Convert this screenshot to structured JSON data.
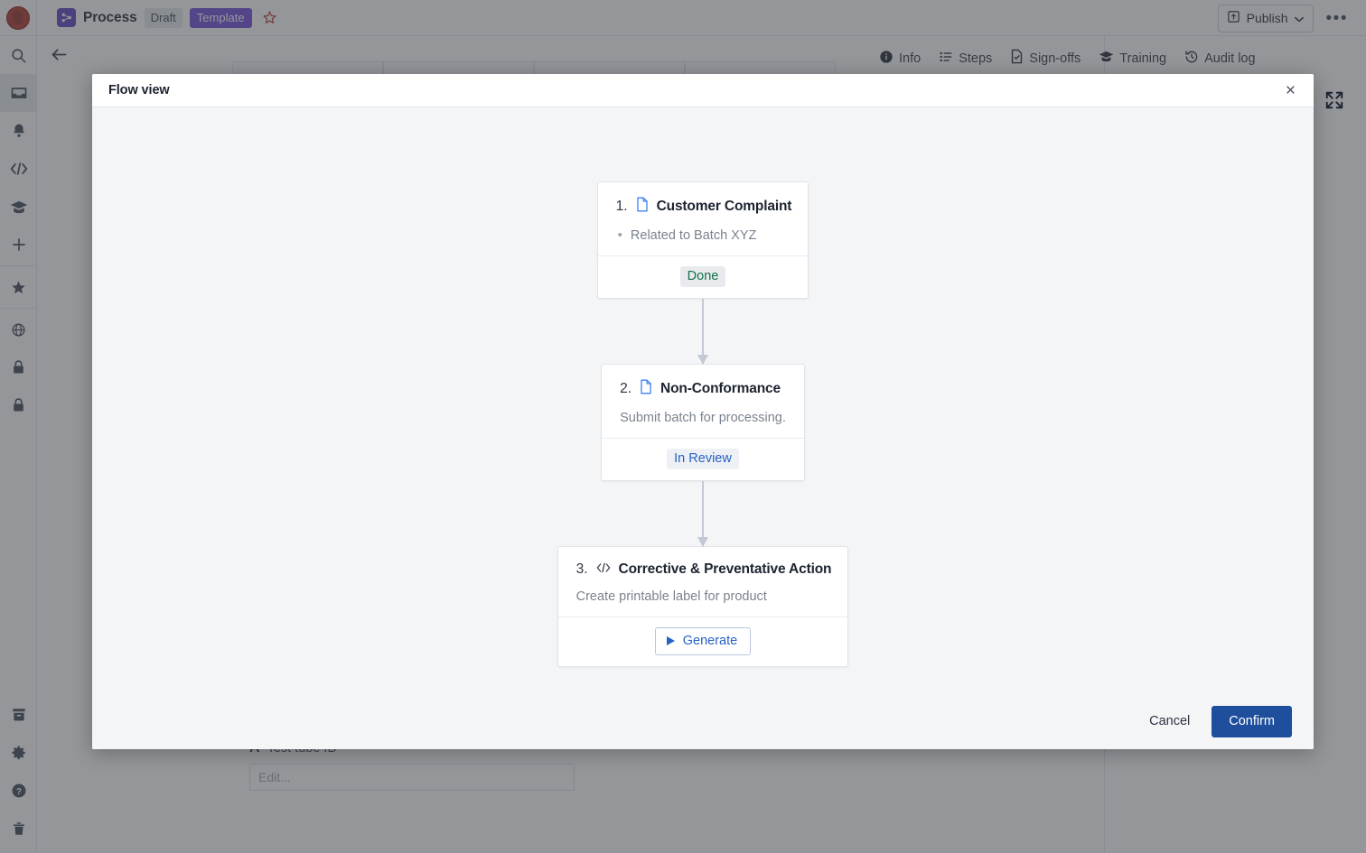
{
  "topbar": {
    "logo_name": "company-logo",
    "doc_icon": "process-flow-icon",
    "doc_title": "Process",
    "status_pill": "Draft",
    "type_pill": "Template",
    "star_icon": "star-outline-icon",
    "publish_label": "Publish",
    "publish_icon": "publish-upload-icon",
    "chevron_icon": "chevron-down-icon",
    "more_label": "•••"
  },
  "sidebar": {
    "items": [
      {
        "name": "search-icon",
        "active": false
      },
      {
        "name": "inbox-icon",
        "active": true
      },
      {
        "name": "bell-icon",
        "active": false
      },
      {
        "name": "code-icon",
        "active": false
      },
      {
        "name": "graduation-cap-icon",
        "active": false
      },
      {
        "name": "plus-icon",
        "active": false
      },
      {
        "name": "star-icon",
        "active": false
      },
      {
        "name": "globe-icon",
        "active": false
      },
      {
        "name": "lock-icon",
        "active": false
      },
      {
        "name": "lock-alt-icon",
        "active": false
      }
    ],
    "bottom_items": [
      {
        "name": "archive-icon"
      },
      {
        "name": "gear-icon"
      },
      {
        "name": "help-circle-icon"
      },
      {
        "name": "trash-icon"
      }
    ]
  },
  "page": {
    "back_icon": "back-arrow-icon",
    "field_label": "Test tube ID",
    "field_label_icon": "text-field-icon",
    "field_placeholder": "Edit...",
    "field_value": ""
  },
  "rail_tabs": [
    {
      "label": "Info",
      "icon": "info-icon"
    },
    {
      "label": "Steps",
      "icon": "list-icon"
    },
    {
      "label": "Sign-offs",
      "icon": "signoff-document-icon"
    },
    {
      "label": "Training",
      "icon": "graduation-cap-icon"
    },
    {
      "label": "Audit log",
      "icon": "history-clock-icon"
    }
  ],
  "modal": {
    "title": "Flow view",
    "close_label": "×",
    "expand_icon": "expand-fullscreen-icon",
    "footer": {
      "cancel_label": "Cancel",
      "confirm_label": "Confirm"
    },
    "steps": [
      {
        "number": "1.",
        "icon": "document-icon",
        "title": "Customer Complaint",
        "body": "Related to Batch XYZ",
        "bulleted": true,
        "action_type": "badge",
        "action_label": "Done",
        "action_style": "done"
      },
      {
        "number": "2.",
        "icon": "document-icon",
        "title": "Non-Conformance",
        "body": "Submit batch for processing.",
        "bulleted": false,
        "action_type": "badge",
        "action_label": "In Review",
        "action_style": "review"
      },
      {
        "number": "3.",
        "icon": "code-icon",
        "title": "Corrective & Preventative Action",
        "body": "Create printable label for product",
        "bulleted": false,
        "action_type": "button",
        "action_label": "Generate",
        "action_style": "generate"
      }
    ]
  },
  "colors": {
    "accent_blue": "#2662c4",
    "confirm_blue": "#1f4e9c",
    "template_purple": "#6b47d6",
    "done_green": "#15704b",
    "logo_red": "#b03128",
    "modal_bg": "#f4f5f7"
  }
}
